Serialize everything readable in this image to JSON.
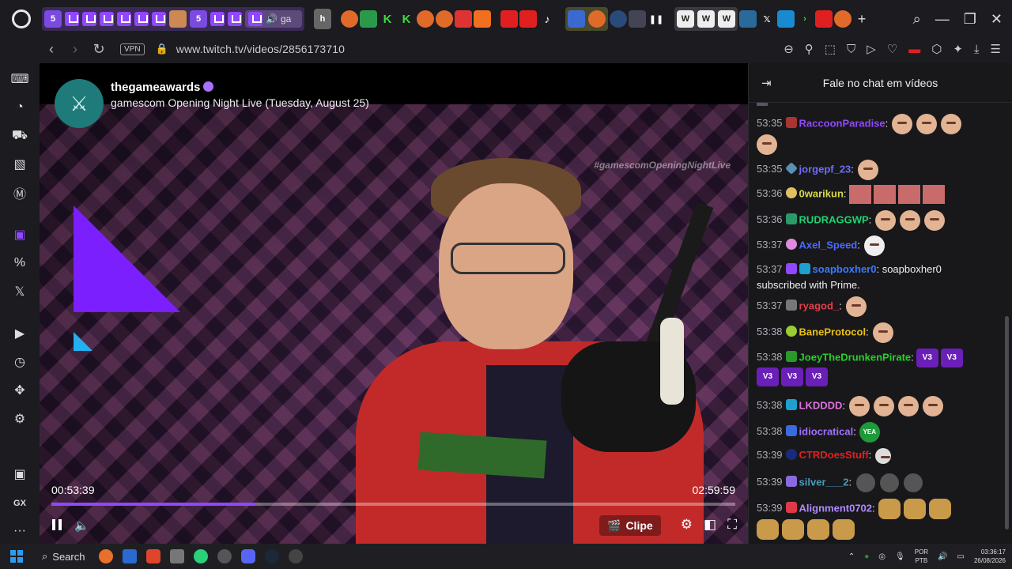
{
  "browser": {
    "active_tab_label": "ga",
    "window_controls": {
      "search": "⌕",
      "minimize": "—",
      "restore": "❐",
      "close": "✕"
    },
    "new_tab": "+"
  },
  "address_bar": {
    "vpn_label": "VPN",
    "url": "www.twitch.tv/videos/2856173710"
  },
  "sidebar": {
    "bottom_label": "GX",
    "more_label": "···"
  },
  "video": {
    "channel_name": "thegameawards",
    "title": "gamescom Opening Night Live (Tuesday, August 25)",
    "overlay_hashtag": "#gamescomOpeningNightLive",
    "time_elapsed": "00:53:39",
    "time_total": "02:59:59",
    "progress": 0.298,
    "clip_label": "Clipe"
  },
  "chat": {
    "header_title": "Fale no chat em vídeos",
    "messages": [
      {
        "time": "53:35",
        "user": "RaccoonParadise",
        "color": "#9147ff",
        "badge_color": "#a33",
        "text": ""
      },
      {
        "time": "53:35",
        "user": "jorgepf_23",
        "color": "#6f6cff",
        "badge_color": "#5a8fb8",
        "text": ""
      },
      {
        "time": "53:36",
        "user": "0warikun",
        "color": "#d9d94a",
        "badge_color": "#e0c060",
        "text": ""
      },
      {
        "time": "53:36",
        "user": "RUDRAGGWP",
        "color": "#1fd470",
        "badge_color": "#2a9a6a",
        "text": ""
      },
      {
        "time": "53:37",
        "user": "Axel_Speed",
        "color": "#4a6aff",
        "badge_color": "#e08ae0",
        "text": ""
      },
      {
        "time": "53:37",
        "user": "soapboxher0",
        "color": "#3a7aff",
        "badge_color": "#9147ff",
        "text": "soapboxher0 subscribed with Prime."
      },
      {
        "time": "53:37",
        "user": "ryagod_",
        "color": "#e0404a",
        "badge_color": "#777",
        "text": ""
      },
      {
        "time": "53:38",
        "user": "BaneProtocol",
        "color": "#e8c018",
        "badge_color": "#9acd32",
        "text": ""
      },
      {
        "time": "53:38",
        "user": "JoeyTheDrunkenPirate",
        "color": "#28d028",
        "badge_color": "#2a9a2a",
        "text": ""
      },
      {
        "time": "53:38",
        "user": "LKDDDD",
        "color": "#e070e0",
        "badge_color": "#1f9fd0",
        "text": ""
      },
      {
        "time": "53:38",
        "user": "idiocratical",
        "color": "#a070ff",
        "badge_color": "#3a6ae0",
        "text": ""
      },
      {
        "time": "53:39",
        "user": "CTRDoesStuff",
        "color": "#e02020",
        "badge_color": "#1a2a7a",
        "text": ""
      },
      {
        "time": "53:39",
        "user": "silver___2",
        "color": "#4a9ab8",
        "badge_color": "#8a6ae0",
        "text": ""
      },
      {
        "time": "53:39",
        "user": "Alignment0702",
        "color": "#b08aff",
        "badge_color": "#e03a4a",
        "text": ""
      }
    ],
    "emote_labels": {
      "we_want": "V3",
      "yea": "YEA"
    }
  },
  "taskbar": {
    "search_label": "Search",
    "lang_top": "POR",
    "lang_bottom": "PTB",
    "clock_time": "03:36:17",
    "clock_date": "26/08/2026"
  }
}
